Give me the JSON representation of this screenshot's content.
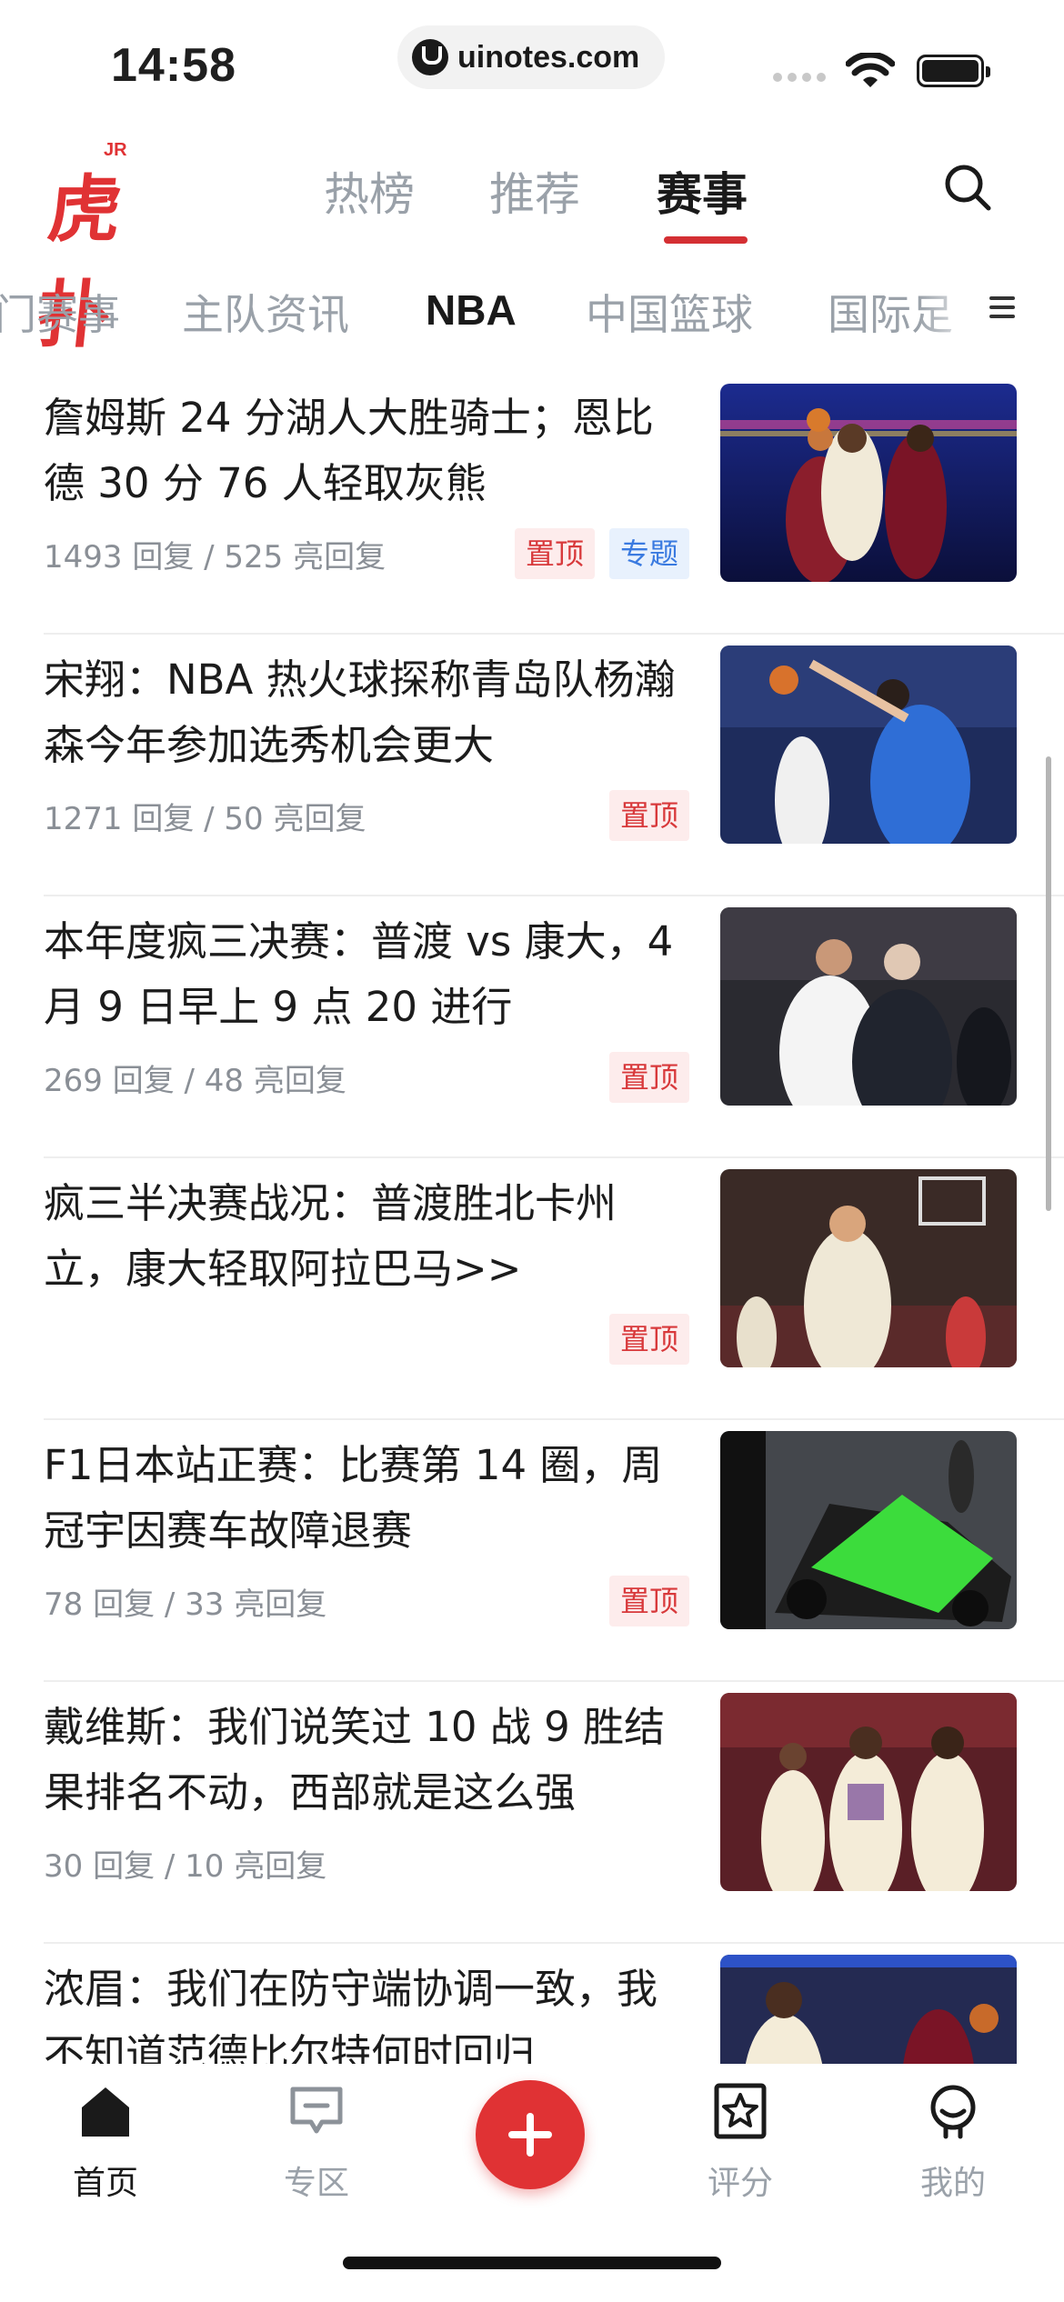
{
  "status_bar": {
    "time": "14:58",
    "url": "uinotes.com"
  },
  "header": {
    "logo_text": "虎扑",
    "logo_badge": "JR",
    "tabs": [
      {
        "label": "热榜",
        "active": false
      },
      {
        "label": "推荐",
        "active": false
      },
      {
        "label": "赛事",
        "active": true
      }
    ],
    "search_icon": "search-icon"
  },
  "sub_tabs": {
    "items": [
      "门赛事",
      "主队资讯",
      "NBA",
      "中国篮球",
      "国际足"
    ],
    "active": "NBA",
    "menu_icon": "menu-icon"
  },
  "news": [
    {
      "title": "詹姆斯 24 分湖人大胜骑士；恩比德 30 分 76 人轻取灰熊",
      "meta": "1493 回复 / 525 亮回复",
      "tags": [
        "置顶",
        "专题"
      ]
    },
    {
      "title": "宋翔：NBA 热火球探称青岛队杨瀚森今年参加选秀机会更大",
      "meta": "1271 回复 / 50 亮回复",
      "tags": [
        "置顶"
      ]
    },
    {
      "title": "本年度疯三决赛：普渡 vs 康大，4 月 9 日早上 9 点 20 进行",
      "meta": "269 回复 / 48 亮回复",
      "tags": [
        "置顶"
      ]
    },
    {
      "title": "疯三半决赛战况：普渡胜北卡州立，康大轻取阿拉巴马>>",
      "meta": "",
      "tags": [
        "置顶"
      ]
    },
    {
      "title": "F1日本站正赛：比赛第 14 圈，周冠宇因赛车故障退赛",
      "meta": "78 回复 / 33 亮回复",
      "tags": [
        "置顶"
      ]
    },
    {
      "title": "戴维斯：我们说笑过 10 战 9 胜结果排名不动，西部就是这么强",
      "meta": "30 回复 / 10 亮回复",
      "tags": []
    },
    {
      "title": "浓眉：我们在防守端协调一致，我不知道范德比尔特何时回归",
      "meta": "",
      "tags": []
    }
  ],
  "tab_bar": {
    "items": [
      {
        "label": "首页",
        "icon": "home-icon",
        "active": true
      },
      {
        "label": "专区",
        "icon": "chat-icon",
        "active": false
      },
      {
        "label": "评分",
        "icon": "rating-icon",
        "active": false
      },
      {
        "label": "我的",
        "icon": "profile-icon",
        "active": false
      }
    ],
    "add_icon": "plus-icon"
  },
  "colors": {
    "brand_red": "#e03234",
    "tag_red_bg": "#fdecec",
    "tag_blue_bg": "#e8f1fd",
    "tag_blue": "#3a7ae0",
    "muted": "#9aa1a9"
  }
}
